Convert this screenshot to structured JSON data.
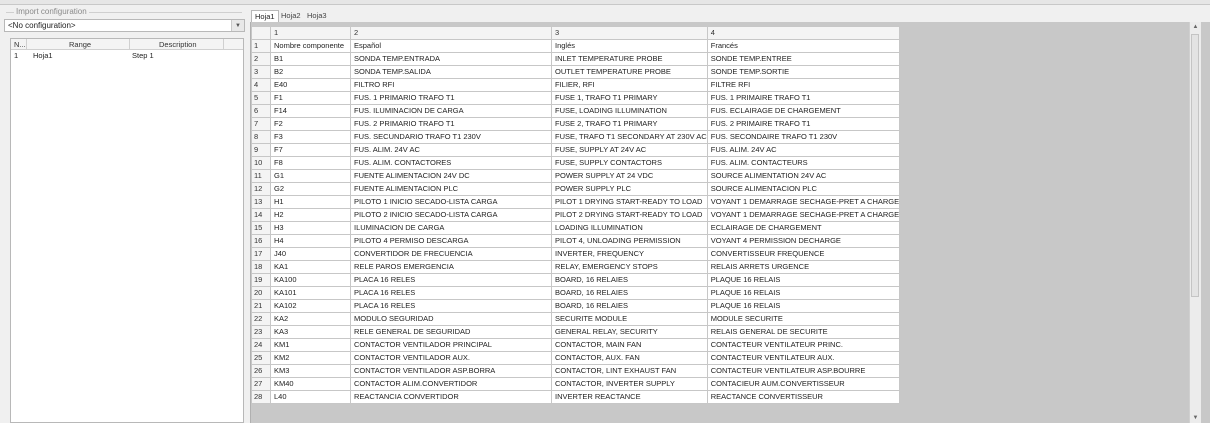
{
  "import_config": {
    "legend": "Import configuration",
    "combo_value": "<No configuration>",
    "list_headers": [
      "N...",
      "Range",
      "Description"
    ],
    "list_rows": [
      {
        "n": "1",
        "range": "Hoja1",
        "description": "Step 1"
      }
    ]
  },
  "sheet_tabs": [
    "Hoja1",
    "Hoja2",
    "Hoja3"
  ],
  "grid": {
    "column_headers": [
      "1",
      "2",
      "3",
      "4"
    ],
    "rows": [
      {
        "n": "1",
        "c": [
          "Nombre componente",
          "Español",
          "Inglés",
          "Francés"
        ]
      },
      {
        "n": "2",
        "c": [
          "B1",
          "SONDA TEMP.ENTRADA",
          "INLET TEMPERATURE PROBE",
          "SONDE TEMP.ENTREE"
        ]
      },
      {
        "n": "3",
        "c": [
          "B2",
          "SONDA TEMP.SALIDA",
          "OUTLET TEMPERATURE PROBE",
          "SONDE TEMP.SORTIE"
        ]
      },
      {
        "n": "4",
        "c": [
          "E40",
          "FILTRO RFI",
          "FILIER, RFI",
          "FILTRE RFI"
        ]
      },
      {
        "n": "5",
        "c": [
          "F1",
          "FUS. 1 PRIMARIO TRAFO T1",
          "FUSE 1, TRAFO T1 PRIMARY",
          "FUS. 1 PRIMAIRE TRAFO T1"
        ]
      },
      {
        "n": "6",
        "c": [
          "F14",
          "FUS. ILUMINACION DE CARGA",
          "FUSE, LOADING ILLUMINATION",
          "FUS. ECLAIRAGE DE CHARGEMENT"
        ]
      },
      {
        "n": "7",
        "c": [
          "F2",
          "FUS. 2 PRIMARIO TRAFO T1",
          "FUSE 2, TRAFO T1 PRIMARY",
          "FUS. 2 PRIMAIRE TRAFO T1"
        ]
      },
      {
        "n": "8",
        "c": [
          "F3",
          "FUS. SECUNDARIO TRAFO T1 230V",
          "FUSE, TRAFO T1 SECONDARY AT 230V AC",
          "FUS. SECONDAIRE TRAFO T1 230V"
        ]
      },
      {
        "n": "9",
        "c": [
          "F7",
          "FUS. ALIM. 24V AC",
          "FUSE, SUPPLY AT 24V AC",
          "FUS. ALIM. 24V AC"
        ]
      },
      {
        "n": "10",
        "c": [
          "F8",
          "FUS. ALIM. CONTACTORES",
          "FUSE, SUPPLY CONTACTORS",
          "FUS. ALIM. CONTACTEURS"
        ]
      },
      {
        "n": "11",
        "c": [
          "G1",
          "FUENTE ALIMENTACION 24V DC",
          "POWER SUPPLY AT 24 VDC",
          "SOURCE ALIMENTATION 24V AC"
        ]
      },
      {
        "n": "12",
        "c": [
          "G2",
          "FUENTE ALIMENTACION PLC",
          "POWER SUPPLY PLC",
          "SOURCE ALIMENTACION PLC"
        ]
      },
      {
        "n": "13",
        "c": [
          "H1",
          "PILOTO 1 INICIO SECADO-LISTA CARGA",
          "PILOT 1 DRYING START-READY TO LOAD",
          "VOYANT 1 DEMARRAGE SECHAGE-PRET A CHARGE"
        ]
      },
      {
        "n": "14",
        "c": [
          "H2",
          "PILOTO 2 INICIO SECADO-LISTA CARGA",
          "PILOT 2 DRYING START-READY TO LOAD",
          "VOYANT 1 DEMARRAGE SECHAGE-PRET A CHARGE"
        ]
      },
      {
        "n": "15",
        "c": [
          "H3",
          "ILUMINACION DE CARGA",
          "LOADING ILLUMINATION",
          "ECLAIRAGE DE CHARGEMENT"
        ]
      },
      {
        "n": "16",
        "c": [
          "H4",
          "PILOTO 4 PERMISO DESCARGA",
          "PILOT 4, UNLOADING PERMISSION",
          "VOYANT 4 PERMISSION DECHARGE"
        ]
      },
      {
        "n": "17",
        "c": [
          "J40",
          "CONVERTIDOR DE FRECUENCIA",
          "INVERTER, FREQUENCY",
          "CONVERTISSEUR FREQUENCE"
        ]
      },
      {
        "n": "18",
        "c": [
          "KA1",
          "RELE PAROS EMERGENCIA",
          "RELAY, EMERGENCY STOPS",
          "RELAIS ARRETS URGENCE"
        ]
      },
      {
        "n": "19",
        "c": [
          "KA100",
          "PLACA 16 RELES",
          "BOARD, 16 RELAIES",
          "PLAQUE 16 RELAIS"
        ]
      },
      {
        "n": "20",
        "c": [
          "KA101",
          "PLACA 16 RELES",
          "BOARD, 16 RELAIES",
          "PLAQUE 16 RELAIS"
        ]
      },
      {
        "n": "21",
        "c": [
          "KA102",
          "PLACA 16 RELES",
          "BOARD, 16 RELAIES",
          "PLAQUE 16 RELAIS"
        ]
      },
      {
        "n": "22",
        "c": [
          "KA2",
          "MODULO SEGURIDAD",
          "SECURITE MODULE",
          "MODULE SECURITE"
        ]
      },
      {
        "n": "23",
        "c": [
          "KA3",
          "RELE GENERAL DE SEGURIDAD",
          "GENERAL RELAY, SECURITY",
          "RELAIS GENERAL DE SECURITE"
        ]
      },
      {
        "n": "24",
        "c": [
          "KM1",
          "CONTACTOR VENTILADOR PRINCIPAL",
          "CONTACTOR, MAIN FAN",
          "CONTACTEUR VENTILATEUR PRINC."
        ]
      },
      {
        "n": "25",
        "c": [
          "KM2",
          "CONTACTOR VENTILADOR AUX.",
          "CONTACTOR, AUX. FAN",
          "CONTACTEUR VENTILATEUR AUX."
        ]
      },
      {
        "n": "26",
        "c": [
          "KM3",
          "CONTACTOR VENTILADOR ASP.BORRA",
          "CONTACTOR, LINT EXHAUST FAN",
          "CONTACTEUR VENTILATEUR ASP.BOURRE"
        ]
      },
      {
        "n": "27",
        "c": [
          "KM40",
          "CONTACTOR ALIM.CONVERTIDOR",
          "CONTACTOR, INVERTER SUPPLY",
          "CONTACIEUR AUM.CONVERTISSEUR"
        ]
      },
      {
        "n": "28",
        "c": [
          "L40",
          "REACTANCIA CONVERTIDOR",
          "INVERTER REACTANCE",
          "REACTANCE CONVERTISSEUR"
        ]
      }
    ]
  }
}
